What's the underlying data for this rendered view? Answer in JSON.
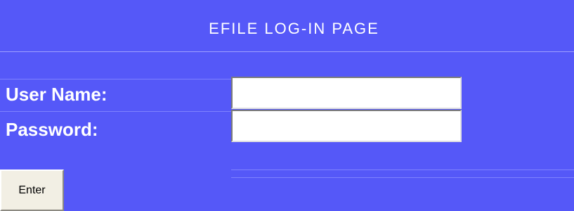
{
  "header": {
    "title": "EFILE LOG-IN PAGE"
  },
  "form": {
    "username_label": "User Name:",
    "username_value": "",
    "password_label": "Password:",
    "password_value": "",
    "enter_label": "Enter"
  },
  "colors": {
    "background": "#5558f8",
    "text": "#ffffff",
    "button_face": "#f2efe4"
  }
}
